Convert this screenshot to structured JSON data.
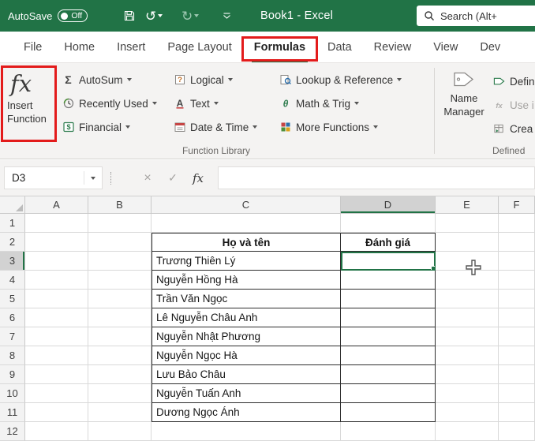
{
  "titlebar": {
    "autosave_label": "AutoSave",
    "autosave_state": "Off",
    "doc_title": "Book1 - Excel",
    "search_text": "Search (Alt+"
  },
  "tabs": {
    "items": [
      "File",
      "Home",
      "Insert",
      "Page Layout",
      "Formulas",
      "Data",
      "Review",
      "View",
      "Dev"
    ],
    "active": "Formulas"
  },
  "ribbon": {
    "insert_function_icon": "fx",
    "insert_function_label": "Insert Function",
    "function_library": {
      "group_label": "Function Library",
      "items": [
        "AutoSum",
        "Recently Used",
        "Financial",
        "Logical",
        "Text",
        "Date & Time",
        "Lookup & Reference",
        "Math & Trig",
        "More Functions"
      ]
    },
    "defined_names": {
      "group_label": "Defined",
      "name_manager_label": "Name Manager",
      "items": [
        "Defin",
        "Use i",
        "Crea"
      ]
    }
  },
  "formula_bar": {
    "name_box": "D3",
    "cancel_glyph": "×",
    "enter_glyph": "✓",
    "fx_label": "fx"
  },
  "grid": {
    "col_headers": [
      "A",
      "B",
      "C",
      "D",
      "E",
      "F"
    ],
    "row_headers": [
      "1",
      "2",
      "3",
      "4",
      "5",
      "6",
      "7",
      "8",
      "9",
      "10",
      "11",
      "12"
    ],
    "selected_cell": "D3",
    "table": {
      "headers": [
        "Họ và tên",
        "Đánh giá"
      ],
      "names": [
        "Trương Thiên Lý",
        "Nguyễn Hồng Hà",
        "Trần Văn Ngọc",
        "Lê Nguyễn Châu Anh",
        "Nguyễn Nhật Phương",
        "Nguyễn Ngọc Hà",
        "Lưu Bảo Châu",
        "Nguyễn Tuấn Anh",
        "Dương Ngọc Ánh"
      ]
    }
  },
  "colors": {
    "accent": "#217346",
    "highlight": "#e31b1b"
  }
}
